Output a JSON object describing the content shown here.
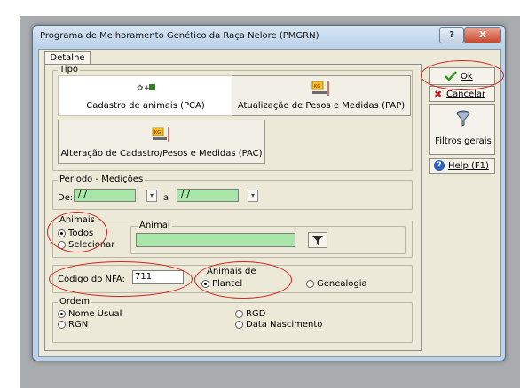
{
  "window": {
    "title": "Programa de Melhoramento Genético da Raça Nelore (PMGRN)",
    "help_button": "?",
    "close_button": "X"
  },
  "tabs": [
    "Detalhe"
  ],
  "tipo": {
    "label": "Tipo",
    "options": [
      {
        "label": "Cadastro de animais (PCA)",
        "icon": "cattle-add-icon",
        "selected": true
      },
      {
        "label": "Atualização de Pesos e Medidas (PAP)",
        "icon": "scale-icon",
        "selected": false
      },
      {
        "label": "Alteração de Cadastro/Pesos e Medidas (PAC)",
        "icon": "scale-icon",
        "selected": false
      }
    ]
  },
  "periodo": {
    "label": "Período - Medições",
    "from_label": "De:",
    "from_value": " / /",
    "to_label": "a",
    "to_value": " / /"
  },
  "animais": {
    "label": "Animais",
    "options": [
      {
        "label": "Todos",
        "selected": true
      },
      {
        "label": "Selecionar",
        "selected": false
      }
    ],
    "animal_label": "Animal",
    "animal_value": ""
  },
  "nfa": {
    "label": "Código do NFA:",
    "value": "711"
  },
  "animais_de": {
    "label": "Animais de",
    "options": [
      {
        "label": "Plantel",
        "selected": true
      },
      {
        "label": "Genealogia",
        "selected": false
      }
    ]
  },
  "ordem": {
    "label": "Ordem",
    "options": [
      {
        "label": "Nome Usual",
        "selected": true
      },
      {
        "label": "RGN",
        "selected": false
      },
      {
        "label": "RGD",
        "selected": false
      },
      {
        "label": "Data Nascimento",
        "selected": false
      }
    ]
  },
  "actions": {
    "ok": "Ok",
    "cancel": "Cancelar",
    "filters": "Filtros gerais",
    "help": "Help (F1)"
  },
  "colors": {
    "date_field": "#a9e6a9",
    "annotation": "#d3221a",
    "window_frame": "#bcd3ea"
  }
}
